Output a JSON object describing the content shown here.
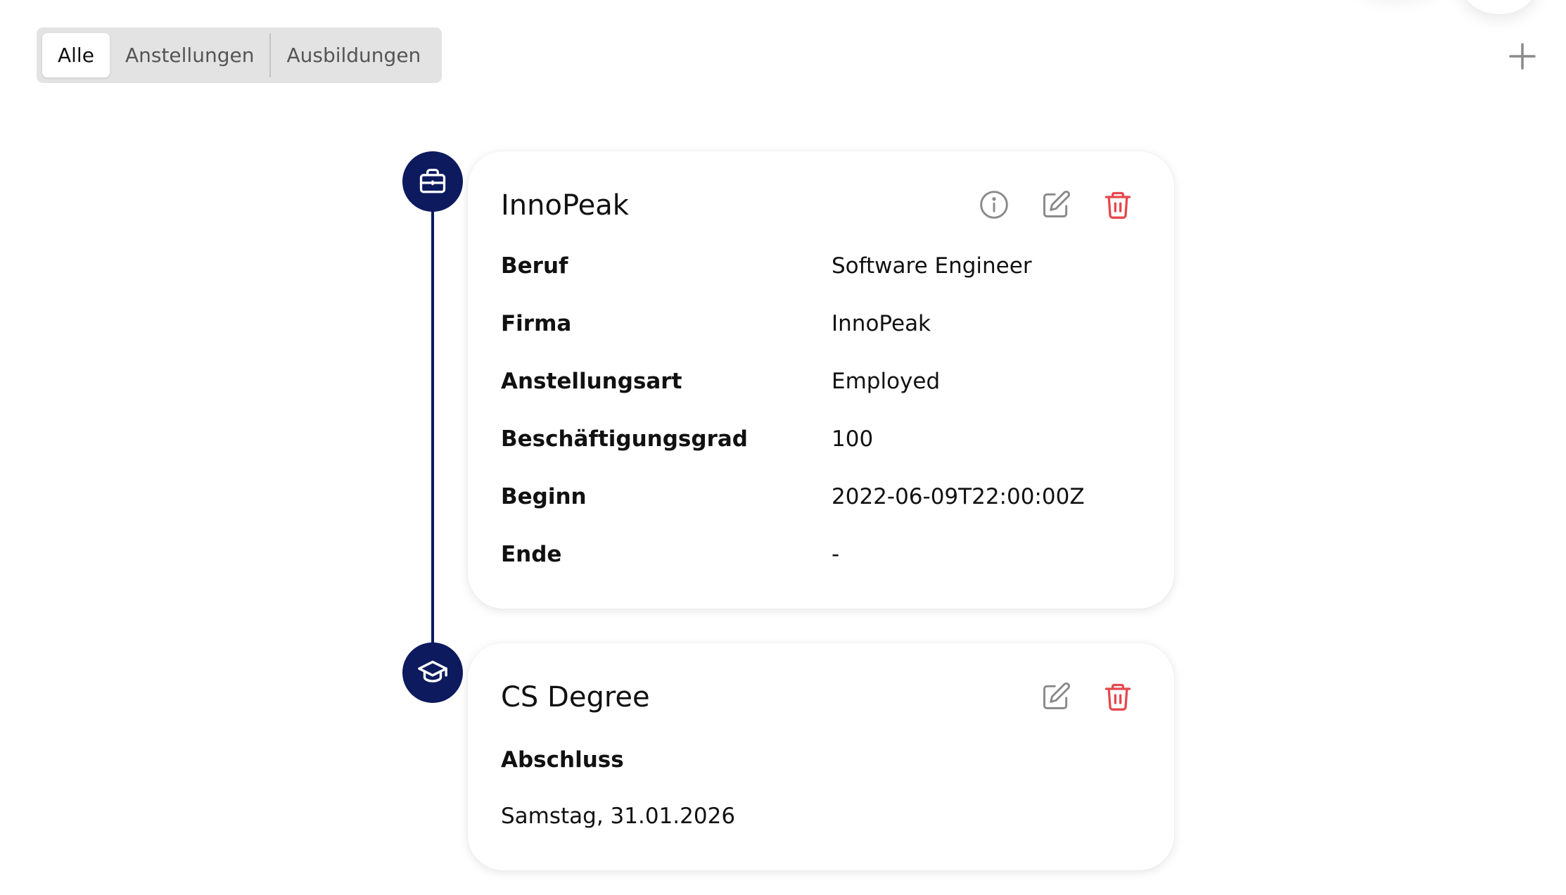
{
  "filter": {
    "tabs": [
      {
        "label": "Alle",
        "active": true
      },
      {
        "label": "Anstellungen",
        "active": false
      },
      {
        "label": "Ausbildungen",
        "active": false
      }
    ]
  },
  "icons": {
    "add": "plus-icon",
    "employment": "briefcase-icon",
    "education": "graduation-cap-icon",
    "info": "info-icon",
    "edit": "pencil-icon",
    "delete": "trash-icon"
  },
  "colors": {
    "timeline": "#0d1a5e",
    "delete": "#e5484d",
    "icon_gray": "#8a8a8a"
  },
  "entries": [
    {
      "type": "employment",
      "title": "InnoPeak",
      "fields": [
        {
          "label": "Beruf",
          "value": "Software Engineer"
        },
        {
          "label": "Firma",
          "value": "InnoPeak"
        },
        {
          "label": "Anstellungsart",
          "value": "Employed"
        },
        {
          "label": "Beschäftigungsgrad",
          "value": "100"
        },
        {
          "label": "Beginn",
          "value": "2022-06-09T22:00:00Z"
        },
        {
          "label": "Ende",
          "value": "-"
        }
      ]
    },
    {
      "type": "education",
      "title": "CS Degree",
      "graduation_label": "Abschluss",
      "graduation_value": "Samstag, 31.01.2026"
    }
  ]
}
